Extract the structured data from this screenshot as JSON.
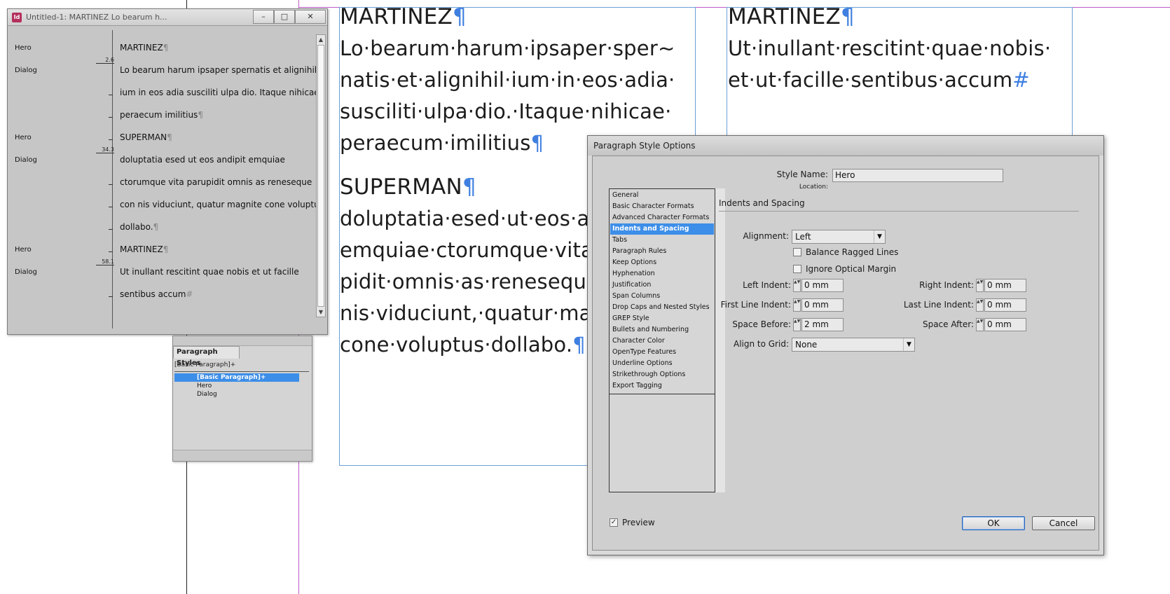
{
  "layout_text": {
    "col1": [
      {
        "text": "MARTINEZ",
        "head": true,
        "pil": "¶"
      },
      {
        "text": "Lo·bearum·harum·ipsaper·sper~",
        "pil": ""
      },
      {
        "text": "natis·et·alignihil·ium·in·eos·adia·",
        "pil": ""
      },
      {
        "text": "susciliti·ulpa·dio.·Itaque·nihicae·",
        "pil": ""
      },
      {
        "text": "peraecum·imilitius",
        "pil": "¶"
      },
      {
        "text": "SUPERMAN",
        "head": true,
        "pil": "¶"
      },
      {
        "text": "doluptatia·esed·ut·eos·an",
        "pil": ""
      },
      {
        "text": "emquiae·ctorumque·vita",
        "pil": ""
      },
      {
        "text": "pidit·omnis·as·reneseque",
        "pil": ""
      },
      {
        "text": "nis·viduciunt,·quatur·mag",
        "pil": ""
      },
      {
        "text": "cone·voluptus·dollabo.",
        "pil": "¶"
      }
    ],
    "col2": [
      {
        "text": "MARTINEZ",
        "head": true,
        "pil": "¶"
      },
      {
        "text": "Ut·inullant·rescitint·quae·nobis·",
        "pil": ""
      },
      {
        "text": "et·ut·facille·sentibus·accum",
        "pil": "#"
      }
    ]
  },
  "story_editor": {
    "title": "Untitled-1: MARTINEZ Lo bearum h...",
    "rows": [
      {
        "style": "Hero",
        "depth": "",
        "text": "MARTINEZ",
        "pil": "¶"
      },
      {
        "style": "Dialog",
        "depth": "2.6",
        "text": "Lo bearum harum ipsaper spernatis et alignihil",
        "pil": ""
      },
      {
        "style": "",
        "depth": "",
        "text": "ium in eos adia susciliti ulpa dio. Itaque nihicae",
        "pil": ""
      },
      {
        "style": "",
        "depth": "",
        "text": "peraecum imilitius",
        "pil": "¶"
      },
      {
        "style": "Hero",
        "depth": "",
        "text": "SUPERMAN",
        "pil": "¶"
      },
      {
        "style": "Dialog",
        "depth": "34.3",
        "text": "doluptatia esed ut eos andipit emquiae",
        "pil": ""
      },
      {
        "style": "",
        "depth": "",
        "text": "ctorumque vita parupidit omnis as reneseque",
        "pil": ""
      },
      {
        "style": "",
        "depth": "",
        "text": "con nis viduciunt, quatur magnite cone voluptus",
        "pil": ""
      },
      {
        "style": "",
        "depth": "",
        "text": "dollabo.",
        "pil": "¶"
      },
      {
        "style": "Hero",
        "depth": "",
        "text": "MARTINEZ",
        "pil": "¶"
      },
      {
        "style": "Dialog",
        "depth": "58.1",
        "text": "Ut inullant rescitint quae nobis et ut facille",
        "pil": ""
      },
      {
        "style": "",
        "depth": "",
        "text": "sentibus accum",
        "pil": "#"
      }
    ]
  },
  "paragraph_styles_panel": {
    "tab_label": "Paragraph Styles",
    "current_style": "[Basic Paragraph]+",
    "items": [
      "[Basic Paragraph]+",
      "Hero",
      "Dialog"
    ],
    "selected_index": 0
  },
  "dialog": {
    "title": "Paragraph Style Options",
    "categories": [
      "General",
      "Basic Character Formats",
      "Advanced Character Formats",
      "Indents and Spacing",
      "Tabs",
      "Paragraph Rules",
      "Keep Options",
      "Hyphenation",
      "Justification",
      "Span Columns",
      "Drop Caps and Nested Styles",
      "GREP Style",
      "Bullets and Numbering",
      "Character Color",
      "OpenType Features",
      "Underline Options",
      "Strikethrough Options",
      "Export Tagging"
    ],
    "selected_category": "Indents and Spacing",
    "style_name_label": "Style Name:",
    "style_name_value": "Hero",
    "location_label": "Location:",
    "section_title": "Indents and Spacing",
    "alignment_label": "Alignment:",
    "alignment_value": "Left",
    "balance_ragged_label": "Balance Ragged Lines",
    "ignore_optical_label": "Ignore Optical Margin",
    "left_indent_label": "Left Indent:",
    "left_indent_value": "0 mm",
    "right_indent_label": "Right Indent:",
    "right_indent_value": "0 mm",
    "first_line_label": "First Line Indent:",
    "first_line_value": "0 mm",
    "last_line_label": "Last Line Indent:",
    "last_line_value": "0 mm",
    "space_before_label": "Space Before:",
    "space_before_value": "2 mm",
    "space_after_label": "Space After:",
    "space_after_value": "0 mm",
    "align_grid_label": "Align to Grid:",
    "align_grid_value": "None",
    "preview_label": "Preview",
    "preview_checked": true,
    "ok_label": "OK",
    "cancel_label": "Cancel"
  },
  "icons": {
    "minimize": "–",
    "maximize": "□",
    "close": "✕",
    "dropdown": "▼",
    "checkmark": "✓",
    "spin": "▲▼",
    "scroll_up": "▲",
    "scroll_down": "▼"
  },
  "colors": {
    "selection": "#3d8ee8",
    "pilcrow": "#3f7fe0",
    "frame_edge": "#6d9fd6",
    "guide": "#c05bc8"
  }
}
